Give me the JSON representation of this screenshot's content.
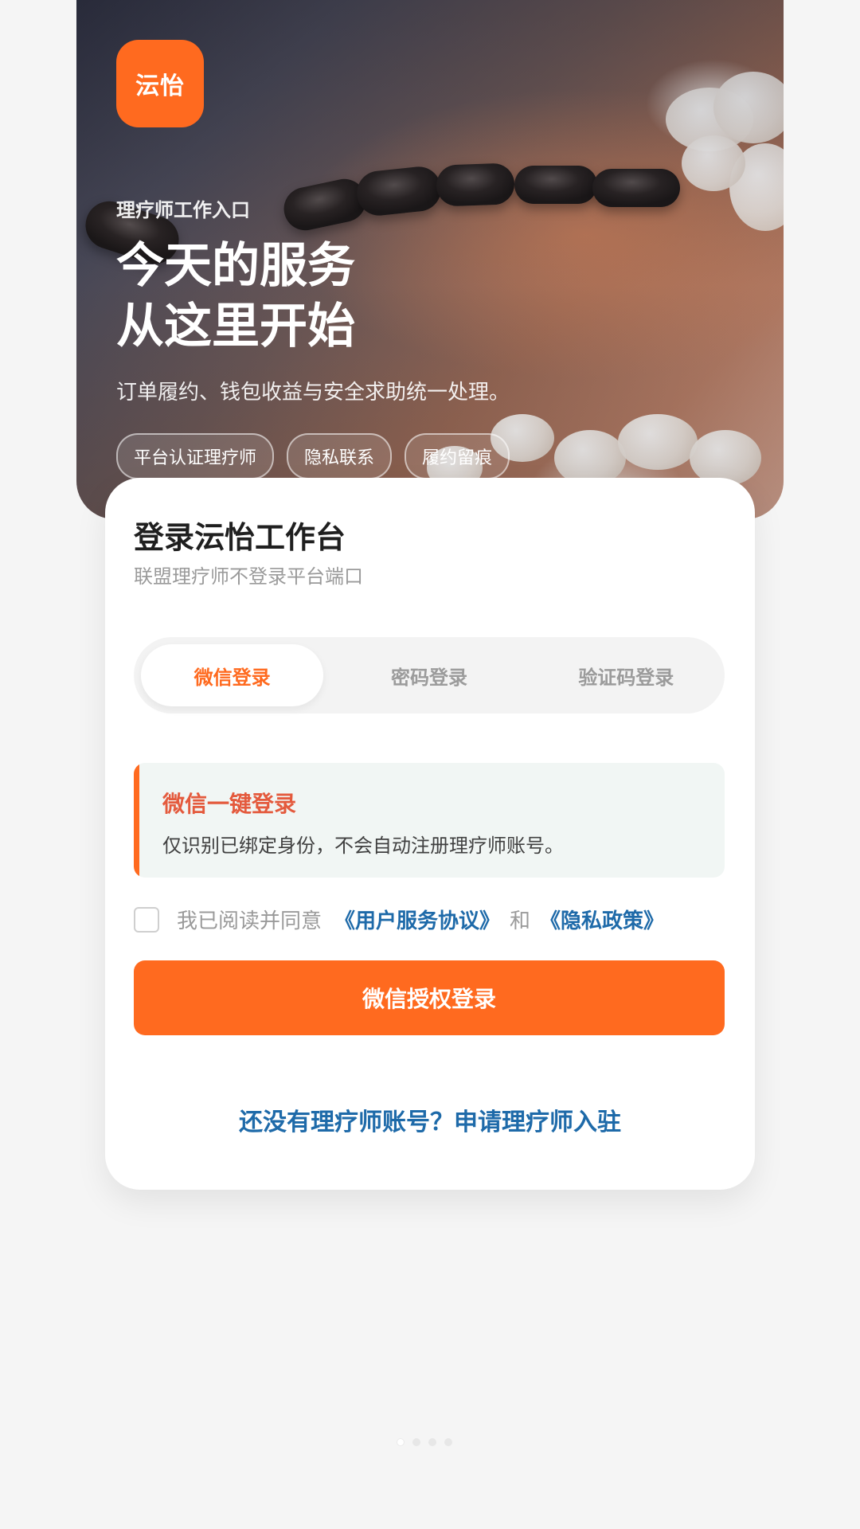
{
  "hero": {
    "logo_text": "沄怡",
    "eyebrow": "理疗师工作入口",
    "title_line1": "今天的服务",
    "title_line2": "从这里开始",
    "subtitle": "订单履约、钱包收益与安全求助统一处理。",
    "chips": [
      "平台认证理疗师",
      "隐私联系",
      "履约留痕"
    ]
  },
  "card": {
    "title": "登录沄怡工作台",
    "subtitle": "联盟理疗师不登录平台端口",
    "tabs": [
      {
        "label": "微信登录",
        "active": true
      },
      {
        "label": "密码登录",
        "active": false
      },
      {
        "label": "验证码登录",
        "active": false
      }
    ],
    "notice": {
      "title": "微信一键登录",
      "text": "仅识别已绑定身份，不会自动注册理疗师账号。"
    },
    "agreement": {
      "prefix": "我已阅读并同意",
      "terms": "《用户服务协议》",
      "and": "和",
      "privacy": "《隐私政策》",
      "checked": false
    },
    "primary_button": "微信授权登录",
    "register_link": "还没有理疗师账号？申请理疗师入驻"
  },
  "colors": {
    "accent": "#ff6a1f",
    "link": "#1e6aa9",
    "notice_title": "#e45a3d"
  },
  "pager": {
    "count": 4,
    "active": 0
  }
}
